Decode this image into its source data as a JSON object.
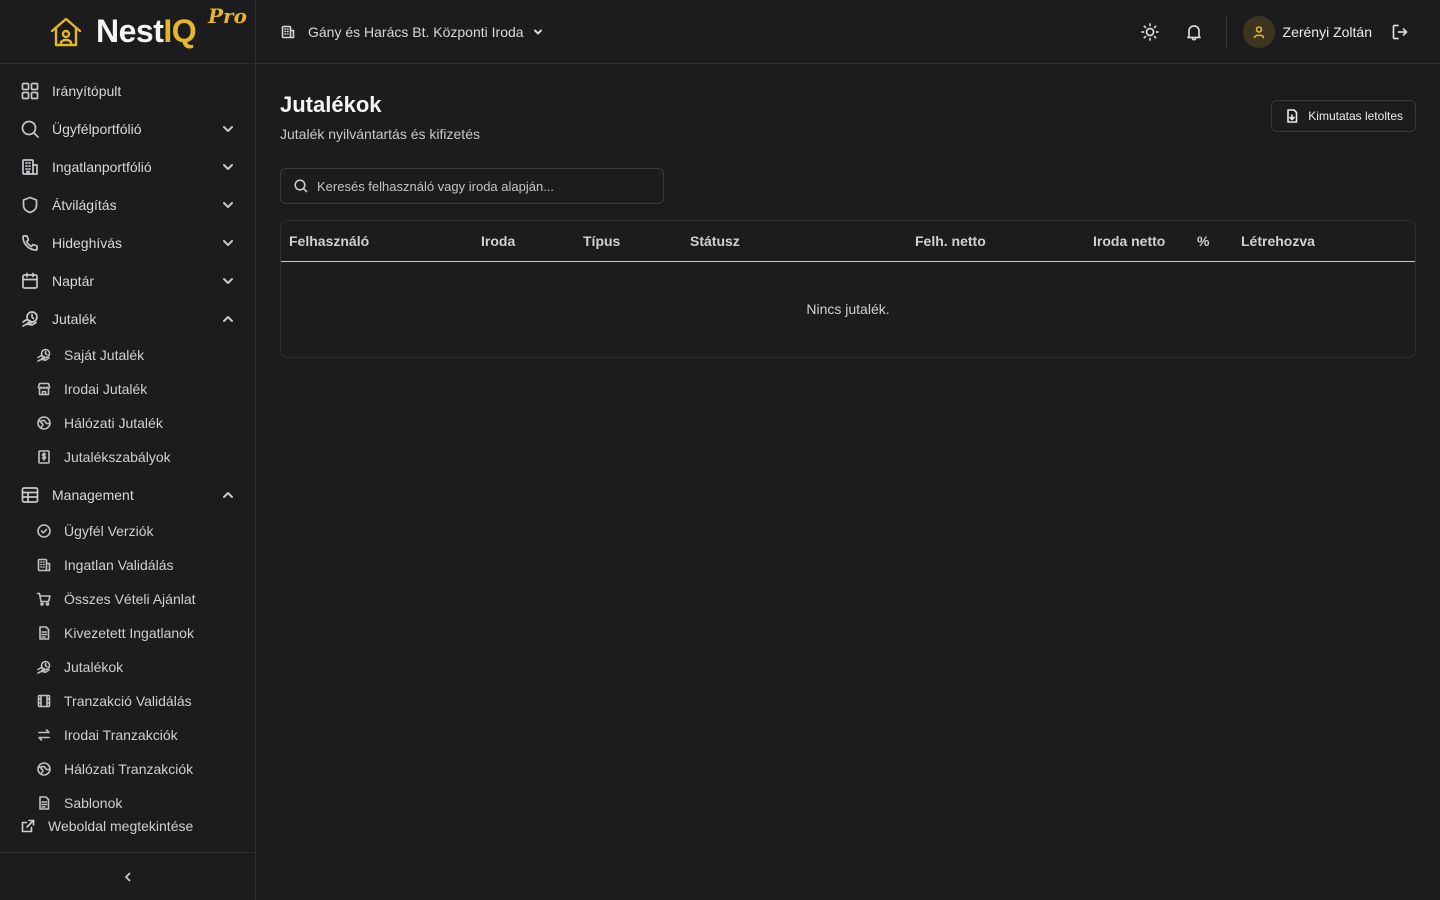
{
  "brand": {
    "name_a": "Nest",
    "name_b": "IQ",
    "badge": "Pro"
  },
  "sidebar": {
    "items": [
      {
        "label": "Irányítópult",
        "icon": "dashboard-icon"
      },
      {
        "label": "Ügyfélportfólió",
        "icon": "search-icon"
      },
      {
        "label": "Ingatlanportfólió",
        "icon": "building-icon"
      },
      {
        "label": "Átvilágítás",
        "icon": "shield-icon"
      },
      {
        "label": "Hideghívás",
        "icon": "phone-icon"
      },
      {
        "label": "Naptár",
        "icon": "calendar-icon"
      },
      {
        "label": "Jutalék",
        "icon": "coins-icon"
      }
    ],
    "jutalek_sub": [
      {
        "label": "Saját Jutalék",
        "icon": "coins-icon"
      },
      {
        "label": "Irodai Jutalék",
        "icon": "store-icon"
      },
      {
        "label": "Hálózati Jutalék",
        "icon": "globe-icon"
      },
      {
        "label": "Jutalékszabályok",
        "icon": "receipt-icon"
      }
    ],
    "management": {
      "label": "Management",
      "icon": "table-icon"
    },
    "management_sub": [
      {
        "label": "Ügyfél Verziók",
        "icon": "check-circle-icon"
      },
      {
        "label": "Ingatlan Validálás",
        "icon": "building-icon"
      },
      {
        "label": "Összes Vételi Ajánlat",
        "icon": "cart-icon"
      },
      {
        "label": "Kivezetett Ingatlanok",
        "icon": "document-icon"
      },
      {
        "label": "Jutalékok",
        "icon": "coins-icon"
      },
      {
        "label": "Tranzakció Validálás",
        "icon": "film-icon"
      },
      {
        "label": "Irodai Tranzakciók",
        "icon": "swap-icon"
      },
      {
        "label": "Hálózati Tranzakciók",
        "icon": "globe-icon"
      },
      {
        "label": "Sablonok",
        "icon": "document-icon"
      }
    ],
    "website_link": "Weboldal megtekintése"
  },
  "topbar": {
    "office": "Gány és Harács Bt. Központi Iroda",
    "user_name": "Zerényi Zoltán"
  },
  "main": {
    "title": "Jutalékok",
    "subtitle": "Jutalék nyilvántartás és kifizetés",
    "export_label": "Kimutatas letoltes",
    "search_placeholder": "Keresés felhasználó vagy iroda alapján...",
    "table_headers": [
      "Felhasználó",
      "Iroda",
      "Típus",
      "Státusz",
      "Felh. netto",
      "Iroda netto",
      "%",
      "Létrehozva"
    ],
    "empty_text": "Nincs jutalék."
  }
}
